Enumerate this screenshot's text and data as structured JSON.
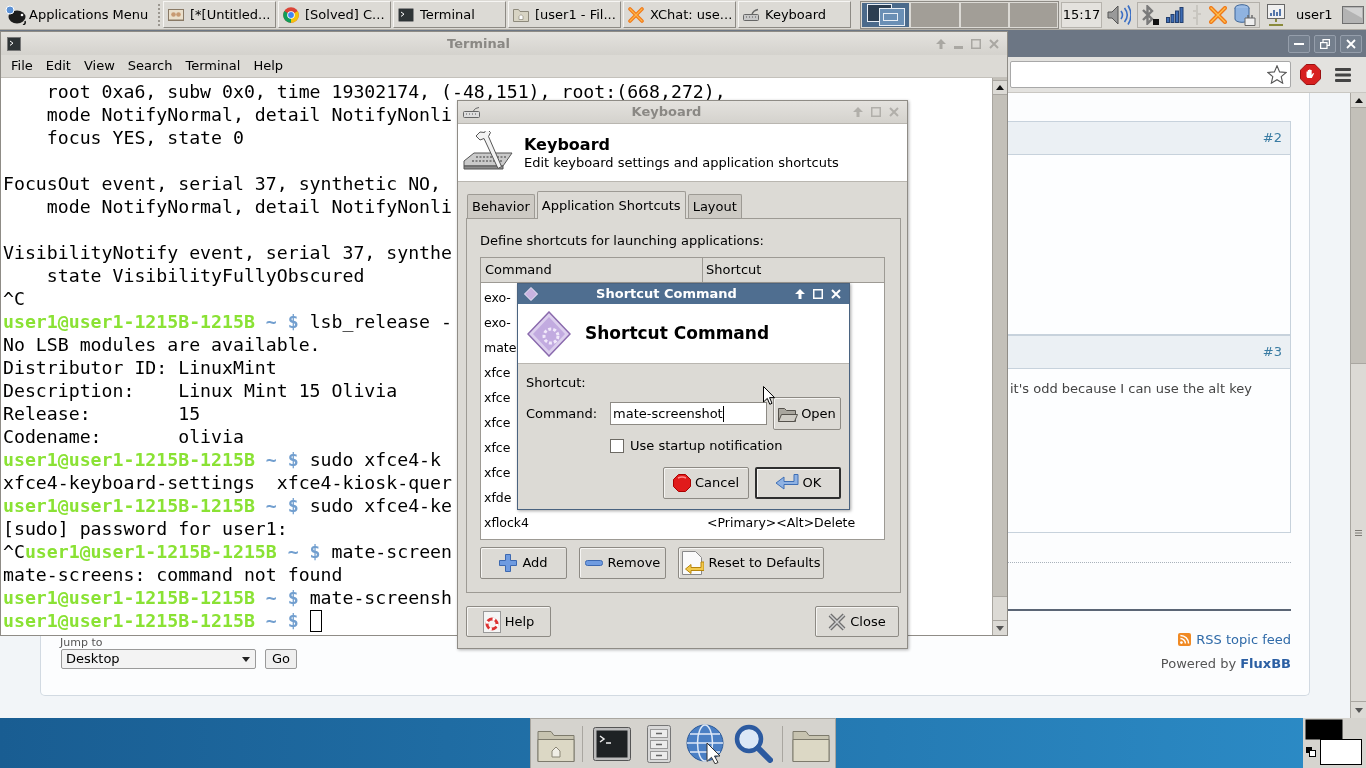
{
  "panel": {
    "menu_label": "Applications Menu",
    "tasks": [
      {
        "kind": "image",
        "label": "[*[Untitled...",
        "selected": false
      },
      {
        "kind": "browser",
        "label": "[Solved] C...",
        "selected": false
      },
      {
        "kind": "terminal",
        "label": "Terminal",
        "selected": false
      },
      {
        "kind": "folder",
        "label": "[user1 - Fil...",
        "selected": false
      },
      {
        "kind": "chat",
        "label": "XChat: use...",
        "selected": false
      },
      {
        "kind": "keyboard",
        "label": "Keyboard",
        "selected": false
      }
    ],
    "workspaces": [
      {
        "selected": true
      },
      {
        "selected": false
      },
      {
        "selected": false
      },
      {
        "selected": false
      }
    ],
    "clock": "15:17",
    "user": "user1"
  },
  "browser": {
    "posts": [
      {
        "number": "#2"
      },
      {
        "number": "#3",
        "text": "it's odd because I can use the alt key"
      }
    ],
    "jump_to": {
      "label": "Jump to",
      "value": "Desktop",
      "button": "Go"
    },
    "rss_link": "RSS topic feed",
    "powered_by": {
      "text": "Powered by",
      "link": "FluxBB"
    }
  },
  "terminal": {
    "title": "Terminal",
    "menu": [
      "File",
      "Edit",
      "View",
      "Search",
      "Terminal",
      "Help"
    ],
    "lines": [
      {
        "kind": "output",
        "indented": true,
        "text": "root 0xa6, subw 0x0, time 19302174, (-48,151), root:(668,272),"
      },
      {
        "kind": "output",
        "indented": true,
        "text": "mode NotifyNormal, detail NotifyNonli"
      },
      {
        "kind": "output",
        "indented": true,
        "text": "focus YES, state 0"
      },
      {
        "kind": "blank"
      },
      {
        "kind": "output",
        "indented": false,
        "text": "FocusOut event, serial 37, synthetic NO,"
      },
      {
        "kind": "output",
        "indented": true,
        "text": "mode NotifyNormal, detail NotifyNonli"
      },
      {
        "kind": "blank"
      },
      {
        "kind": "output",
        "indented": false,
        "text": "VisibilityNotify event, serial 37, synthe"
      },
      {
        "kind": "output",
        "indented": true,
        "text": "state VisibilityFullyObscured"
      },
      {
        "kind": "output",
        "indented": false,
        "text": "^C"
      },
      {
        "kind": "prompt",
        "user": "user1@user1-1215B-1215B",
        "symbol": "~ $",
        "text": "lsb_release -",
        "cursor": false
      },
      {
        "kind": "output",
        "indented": false,
        "text": "No LSB modules are available."
      },
      {
        "kind": "output",
        "indented": false,
        "text": "Distributor ID: LinuxMint"
      },
      {
        "kind": "output",
        "indented": false,
        "text": "Description:    Linux Mint 15 Olivia"
      },
      {
        "kind": "output",
        "indented": false,
        "text": "Release:        15"
      },
      {
        "kind": "output",
        "indented": false,
        "text": "Codename:       olivia"
      },
      {
        "kind": "prompt",
        "user": "user1@user1-1215B-1215B",
        "symbol": "~ $",
        "text": "sudo xfce4-k",
        "cursor": false
      },
      {
        "kind": "output",
        "indented": false,
        "text": "xfce4-keyboard-settings  xfce4-kiosk-quer"
      },
      {
        "kind": "prompt",
        "user": "user1@user1-1215B-1215B",
        "symbol": "~ $",
        "text": "sudo xfce4-ke",
        "cursor": false
      },
      {
        "kind": "output",
        "indented": false,
        "text": "[sudo] password for user1:"
      },
      {
        "kind": "prompt",
        "prefix": "^C",
        "user": "user1@user1-1215B-1215B",
        "symbol": "~ $",
        "text": "mate-screen",
        "cursor": false
      },
      {
        "kind": "output",
        "indented": false,
        "text": "mate-screens: command not found"
      },
      {
        "kind": "prompt",
        "user": "user1@user1-1215B-1215B",
        "symbol": "~ $",
        "text": "mate-screensh",
        "cursor": false
      },
      {
        "kind": "prompt",
        "user": "user1@user1-1215B-1215B",
        "symbol": "~ $",
        "cursor": true
      }
    ]
  },
  "keyboard_dialog": {
    "title": "Keyboard",
    "heading": "Keyboard",
    "subtitle": "Edit keyboard settings and application shortcuts",
    "tabs": [
      {
        "label": "Behavior",
        "selected": false
      },
      {
        "label": "Application Shortcuts",
        "selected": true
      },
      {
        "label": "Layout",
        "selected": false
      }
    ],
    "intro": "Define shortcuts for launching applications:",
    "columns": [
      "Command",
      "Shortcut"
    ],
    "rows": [
      {
        "command": "exo-",
        "selected": false
      },
      {
        "command": "exo-",
        "selected": false
      },
      {
        "command": "mate",
        "selected": false
      },
      {
        "command": "xfce",
        "selected": false
      },
      {
        "command": "xfce",
        "selected": false
      },
      {
        "command": "xfce",
        "selected": false
      },
      {
        "command": "xfce",
        "selected": false
      },
      {
        "command": "xfce",
        "selected": false
      },
      {
        "command": "xfde",
        "selected": false
      },
      {
        "command": "xflock4",
        "shortcut": "<Primary><Alt>Delete",
        "selected": false
      }
    ],
    "actions": [
      {
        "kind": "add",
        "label": "Add"
      },
      {
        "kind": "remove",
        "label": "Remove"
      },
      {
        "kind": "reset",
        "label": "Reset to Defaults"
      }
    ],
    "help_button": "Help",
    "close_button": "Close"
  },
  "shortcut_dialog": {
    "title": "Shortcut Command",
    "heading": "Shortcut Command",
    "shortcut_label": "Shortcut:",
    "command_label": "Command:",
    "command_value": "mate-screenshot",
    "open_button": "Open",
    "startup_notification": {
      "label": "Use startup notification",
      "checked": false
    },
    "cancel_button": "Cancel",
    "ok_button": "OK"
  }
}
